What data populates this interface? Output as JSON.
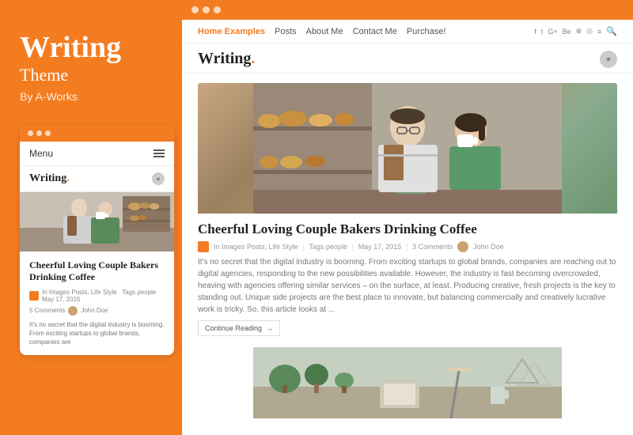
{
  "left": {
    "title": "Writing",
    "subtitle": "Theme",
    "author": "By A-Works"
  },
  "mobile": {
    "menu": "Menu",
    "brand": "Writing",
    "brand_dot": ".",
    "post_title": "Cheerful Loving Couple Bakers Drinking Coffee",
    "meta": "In Images Posts, Life Style  Tags people  May 17, 2015",
    "comments": "5 Comments",
    "author_name": "John Doe",
    "excerpt": "It's no secret that the digital industry is booming. From exciting startups to global brands, companies are"
  },
  "browser": {
    "nav_links": [
      "Home Examples",
      "Posts",
      "About Me",
      "Contact Me",
      "Purchase!"
    ],
    "social_icons": [
      "f",
      "t",
      "G+",
      "Be",
      "⊕",
      "◎",
      "≡"
    ],
    "brand": "Writing",
    "brand_dot": "."
  },
  "featured_post": {
    "title": "Cheerful Loving Couple Bakers Drinking Coffee",
    "meta_prefix": "In Images Posts, Life Style",
    "meta_tags": "Tags people",
    "meta_date": "May 17, 2015",
    "meta_comments": "3 Comments",
    "author": "John Doe",
    "excerpt": "It's no secret that the digital industry is booming. From exciting startups to global brands, companies are reaching out to digital agencies, responding to the new possibilities available. However, the industry is fast becoming overcrowded, heaving with agencies offering similar services – on the surface, at least. Producing creative, fresh projects is the key to standing out. Unique side projects are the best place to innovate, but balancing commercially and creatively lucrative work is tricky. So, this article looks at ...",
    "continue_btn": "Continue Reading"
  }
}
